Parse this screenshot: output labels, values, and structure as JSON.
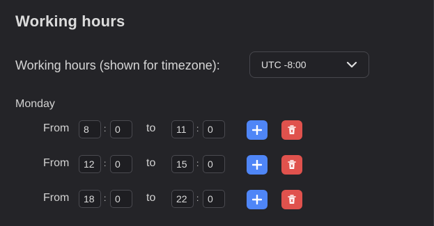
{
  "section": {
    "title": "Working hours"
  },
  "timezone": {
    "label": "Working hours (shown for timezone):",
    "selected": "UTC -8:00"
  },
  "day": {
    "label": "Monday",
    "from_word": "From",
    "to_word": "to",
    "separator": ":",
    "slots": [
      {
        "from_hour": "8",
        "from_minute": "0",
        "to_hour": "11",
        "to_minute": "0"
      },
      {
        "from_hour": "12",
        "from_minute": "0",
        "to_hour": "15",
        "to_minute": "0"
      },
      {
        "from_hour": "18",
        "from_minute": "0",
        "to_hour": "22",
        "to_minute": "0"
      }
    ]
  },
  "icons": {
    "dropdown": "chevron-down-icon",
    "add": "plus-icon",
    "delete": "trash-icon"
  },
  "colors": {
    "background": "#242428",
    "add_button": "#4f86f7",
    "delete_button": "#e0524d"
  }
}
